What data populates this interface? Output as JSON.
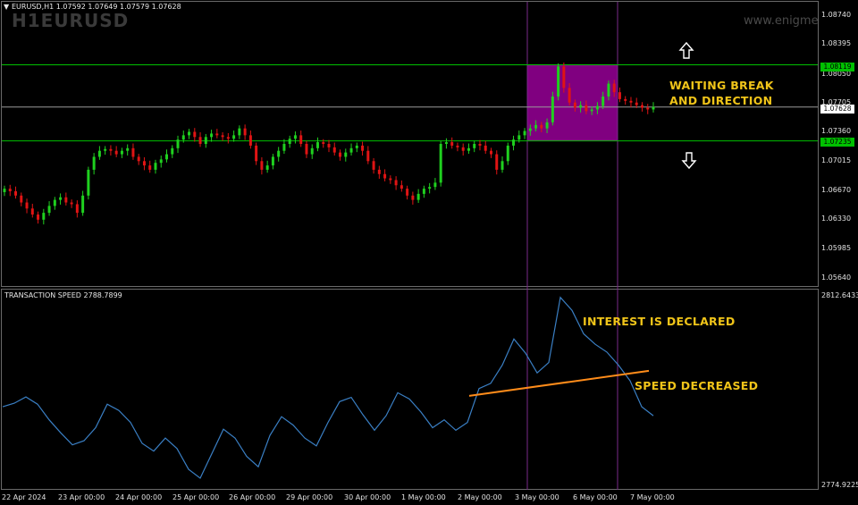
{
  "header": {
    "symbol_line": "EURUSD,H1  1.07592 1.07649 1.07579 1.07628",
    "watermark_symbol": "H1EURUSD",
    "watermark_site": "www.enigme"
  },
  "main_axis": {
    "labels": [
      "1.08740",
      "1.08395",
      "1.08050",
      "1.07705",
      "1.07360",
      "1.07015",
      "1.06670",
      "1.06330",
      "1.05985",
      "1.05640"
    ],
    "tags": [
      {
        "text": "1.08119",
        "color": "#00c000"
      },
      {
        "text": "1.07628",
        "color": "#ffffff"
      },
      {
        "text": "1.07235",
        "color": "#00c000"
      }
    ]
  },
  "indicator": {
    "title": "TRANSACTION SPEED 2788.7899",
    "axis_top": "2812.6433",
    "axis_bottom": "2774.9225"
  },
  "time_axis": [
    "22 Apr 2024",
    "23 Apr 00:00",
    "24 Apr 00:00",
    "25 Apr 00:00",
    "26 Apr 00:00",
    "29 Apr 00:00",
    "30 Apr 00:00",
    "1 May 00:00",
    "2 May 00:00",
    "3 May 00:00",
    "6 May 00:00",
    "7 May 00:00"
  ],
  "annotations": {
    "waiting_line1": "WAITING BREAK",
    "waiting_line2": "AND DIRECTION",
    "interest": "INTEREST IS DECLARED",
    "speed": "SPEED DECREASED",
    "up_arrow_icon": "up-arrow-icon",
    "down_arrow_icon": "down-arrow-icon"
  },
  "colors": {
    "bull": "#1fd01f",
    "bear": "#e01414",
    "level_line": "#00c000",
    "zone": "#800080",
    "speed_line": "#3a7fc4",
    "trend_line": "#ff8c1a",
    "annotation": "#f0c419"
  },
  "chart_data": [
    {
      "type": "candlestick",
      "title": "EURUSD,H1",
      "ylim": [
        1.0555,
        1.0885
      ],
      "levels": [
        1.08119,
        1.07628,
        1.07235
      ],
      "zone": {
        "from": "3 May 00:00",
        "to": "6 May 00:00",
        "low": 1.07235,
        "high": 1.08119
      },
      "closes": [
        1.0668,
        1.0665,
        1.066,
        1.0652,
        1.0645,
        1.0638,
        1.0632,
        1.064,
        1.0648,
        1.0655,
        1.0658,
        1.0652,
        1.065,
        1.064,
        1.066,
        1.069,
        1.0705,
        1.0712,
        1.0714,
        1.0712,
        1.0708,
        1.0712,
        1.0715,
        1.0705,
        1.07,
        1.0695,
        1.069,
        1.0698,
        1.0702,
        1.0708,
        1.0715,
        1.0725,
        1.073,
        1.0734,
        1.0728,
        1.072,
        1.0728,
        1.0732,
        1.073,
        1.0728,
        1.0726,
        1.073,
        1.0738,
        1.073,
        1.0718,
        1.07,
        1.069,
        1.0695,
        1.0705,
        1.0712,
        1.072,
        1.0726,
        1.073,
        1.072,
        1.0708,
        1.0715,
        1.0722,
        1.072,
        1.0716,
        1.071,
        1.0705,
        1.071,
        1.0715,
        1.0718,
        1.0712,
        1.07,
        1.069,
        1.0685,
        1.068,
        1.0678,
        1.0672,
        1.0668,
        1.066,
        1.0655,
        1.0662,
        1.0668,
        1.067,
        1.0675,
        1.072,
        1.0722,
        1.0718,
        1.0716,
        1.0712,
        1.0715,
        1.072,
        1.0718,
        1.0712,
        1.0708,
        1.069,
        1.07,
        1.0718,
        1.0725,
        1.073,
        1.0735,
        1.0738,
        1.0742,
        1.0738,
        1.0745,
        1.0775,
        1.081,
        1.0785,
        1.0768,
        1.0762,
        1.0765,
        1.0758,
        1.076,
        1.0764,
        1.0775,
        1.079,
        1.078,
        1.0772,
        1.077,
        1.0768,
        1.0765,
        1.0762,
        1.076,
        1.0763
      ]
    },
    {
      "type": "line",
      "title": "TRANSACTION SPEED 2788.7899",
      "ylim": [
        2774.9225,
        2812.6433
      ],
      "values": [
        2790.5,
        2791.2,
        2792.4,
        2791.0,
        2788.0,
        2785.5,
        2783.2,
        2784.0,
        2786.5,
        2791.0,
        2789.8,
        2787.5,
        2783.5,
        2782.0,
        2784.5,
        2782.5,
        2778.5,
        2776.8,
        2781.5,
        2786.2,
        2784.5,
        2781.0,
        2779.0,
        2785.0,
        2788.6,
        2787.0,
        2784.5,
        2783.0,
        2787.5,
        2791.5,
        2792.3,
        2789.0,
        2786.0,
        2788.8,
        2793.2,
        2792.0,
        2789.5,
        2786.5,
        2788.0,
        2786.0,
        2787.5,
        2794.0,
        2795.0,
        2798.5,
        2803.5,
        2800.8,
        2797.0,
        2799.0,
        2811.5,
        2809.0,
        2804.5,
        2802.5,
        2801.0,
        2798.5,
        2795.5,
        2790.5,
        2788.8
      ],
      "trendline": {
        "from": 2792.6,
        "to": 2797.4
      }
    }
  ]
}
